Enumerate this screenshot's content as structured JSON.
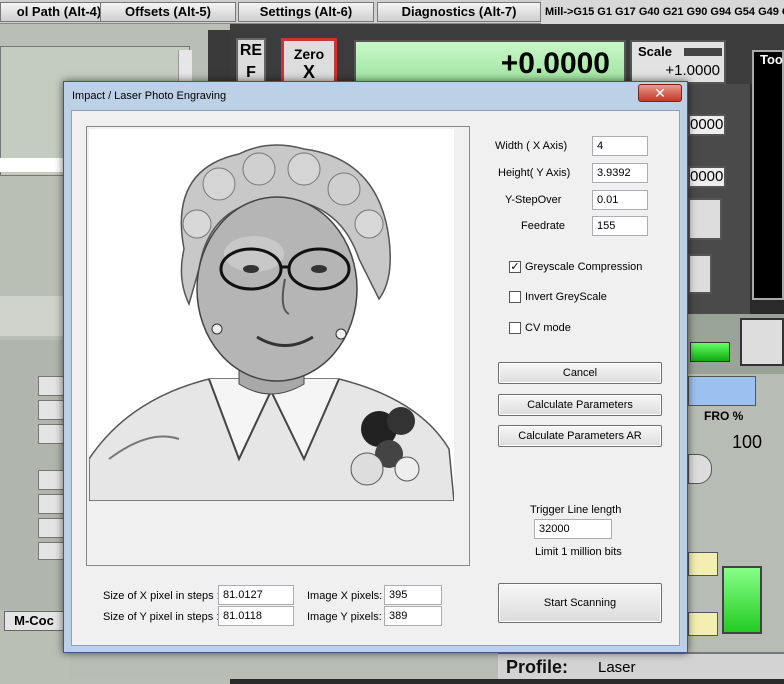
{
  "background": {
    "tabs": [
      "ol Path (Alt-4)",
      "Offsets (Alt-5)",
      "Settings (Alt-6)",
      "Diagnostics (Alt-7)"
    ],
    "gcodes": "Mill->G15  G1 G17 G40 G21 G90 G94 G54 G49 G9",
    "ref_label": "RE\nF",
    "zero_label": "Zero",
    "zero_axis": "X",
    "x_dro": "+0.0000",
    "scale_label": "Scale",
    "scale_value": "+1.0000",
    "dro_2": "0000",
    "dro_3": "0000",
    "tool_label": "Too",
    "fro_label": "FRO %",
    "fro_value": "100",
    "mcode_label": "M-Coc",
    "profile_label": "Profile:",
    "profile_value": "Laser"
  },
  "dialog": {
    "title": "Impact / Laser Photo Engraving",
    "close_glyph": "✕",
    "fields": {
      "width_label": "Width ( X Axis)",
      "width_value": "4",
      "height_label": "Height( Y Axis)",
      "height_value": "3.9392",
      "ystepover_label": "Y-StepOver",
      "ystepover_value": "0.01",
      "feedrate_label": "Feedrate",
      "feedrate_value": "155"
    },
    "checkboxes": {
      "greyscale_label": "Greyscale Compression",
      "greyscale_checked": "✓",
      "invert_label": "Invert GreyScale",
      "cv_label": "CV mode"
    },
    "buttons": {
      "cancel": "Cancel",
      "calc": "Calculate Parameters",
      "calc_ar": "Calculate Parameters AR",
      "start": "Start Scanning"
    },
    "trigger": {
      "label": "Trigger Line length",
      "value": "32000",
      "limit": "Limit 1 million bits"
    },
    "pixels": {
      "x_steps_label": "Size of X pixel in steps :",
      "x_steps_value": "81.0127",
      "y_steps_label": "Size of Y pixel in steps :",
      "y_steps_value": "81.0118",
      "img_x_label": "Image X pixels:",
      "img_x_value": "395",
      "img_y_label": "Image Y pixels:",
      "img_y_value": "389"
    }
  }
}
